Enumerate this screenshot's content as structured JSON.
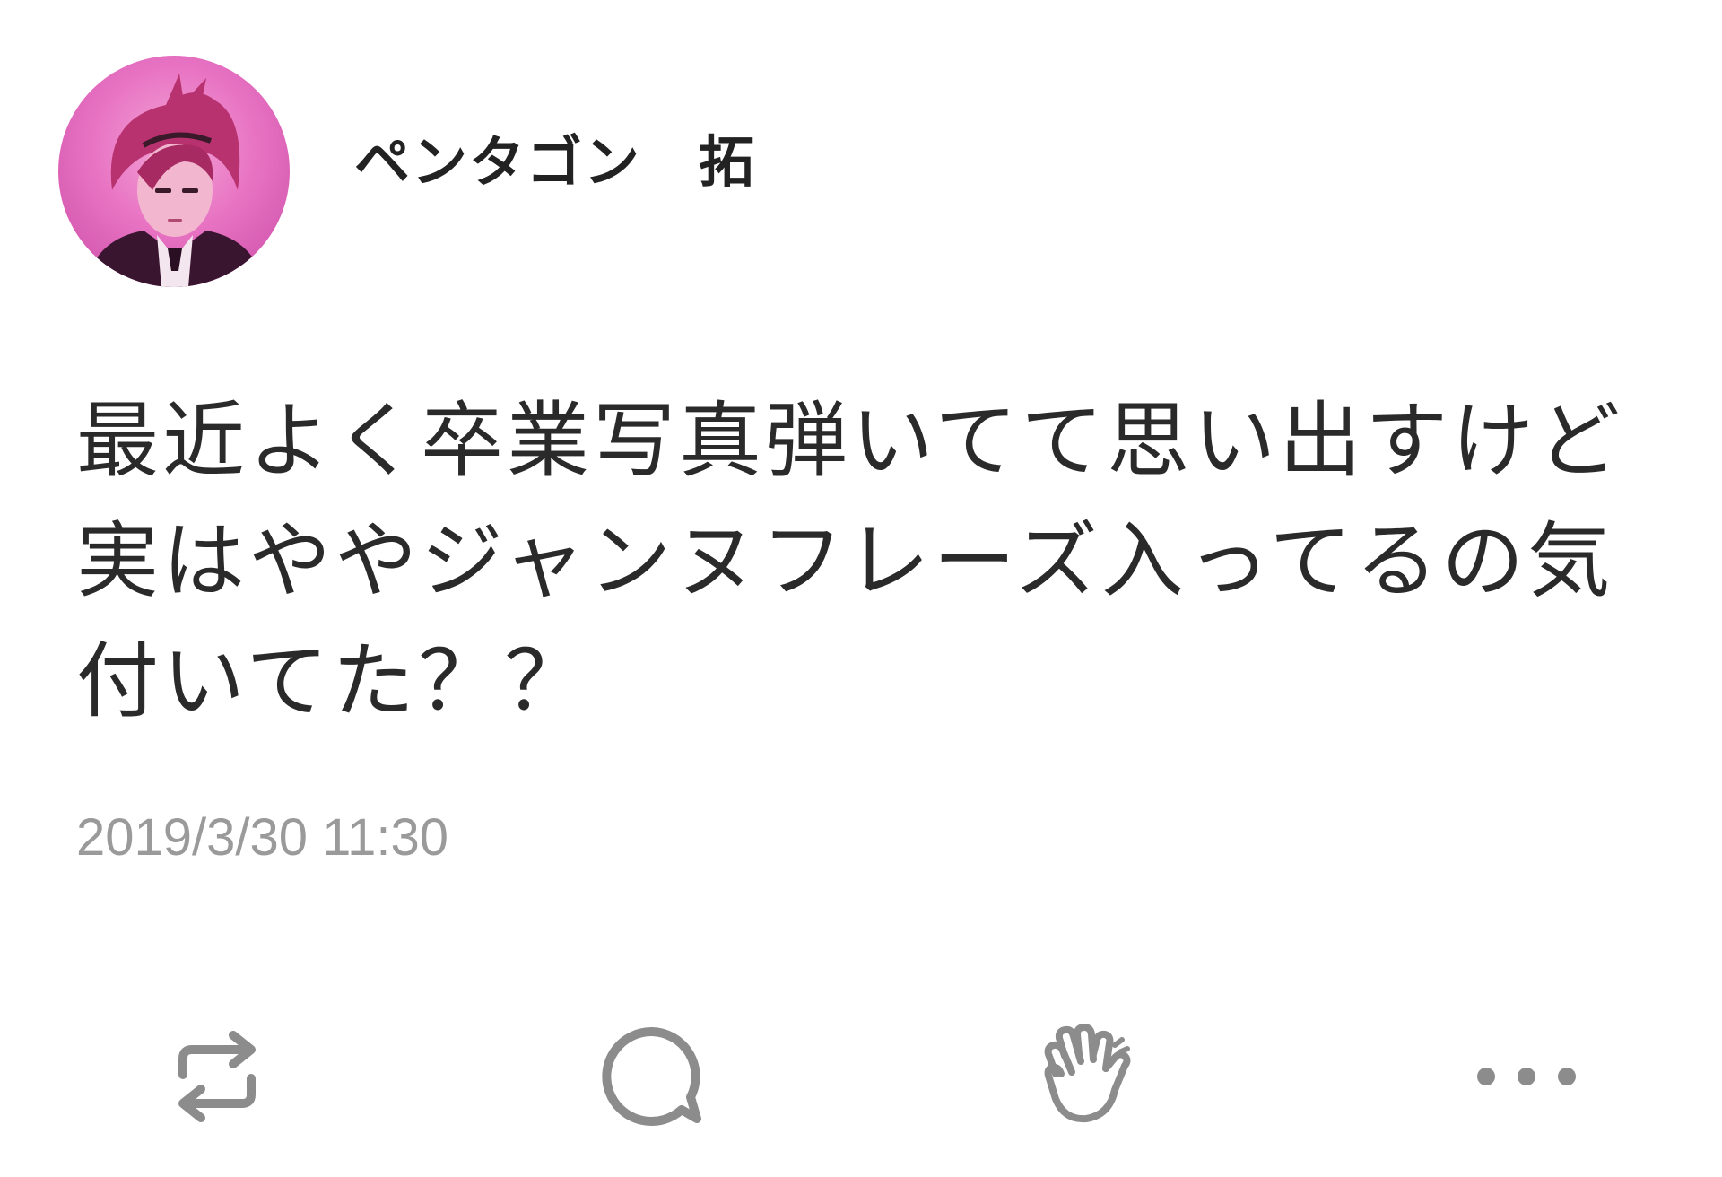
{
  "post": {
    "author_name": "ペンタゴン　拓",
    "avatar_icon": "profile-photo",
    "body": "最近よく卒業写真弾いてて思い出すけど実はややジャンヌフレーズ入ってるの気付いてた？？",
    "timestamp": "2019/3/30 11:30"
  },
  "actions": [
    {
      "name": "repost",
      "icon": "repost-icon"
    },
    {
      "name": "reply",
      "icon": "speech-bubble-icon"
    },
    {
      "name": "clap",
      "icon": "clap-hands-icon"
    },
    {
      "name": "more",
      "icon": "ellipsis-icon"
    }
  ],
  "colors": {
    "text": "#2a2a2a",
    "meta": "#9a9a9a",
    "icon": "#8c8c8c",
    "avatar_accent": "#e873c3"
  }
}
